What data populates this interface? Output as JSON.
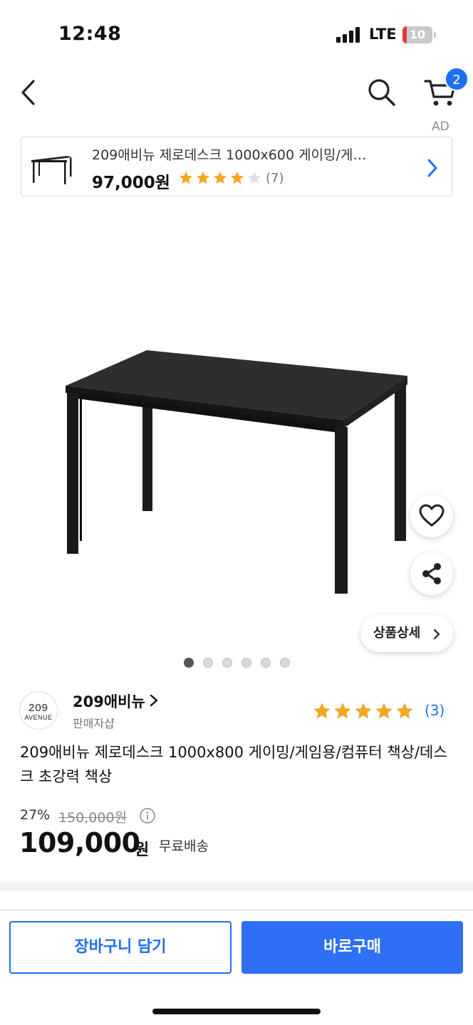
{
  "status_bar": {
    "time": "12:48",
    "network": "LTE",
    "battery_level": "10",
    "battery_color": "#e53935"
  },
  "nav": {
    "back_icon": "chevron-left-icon",
    "search_icon": "search-icon",
    "cart_icon": "cart-icon",
    "cart_count": "2"
  },
  "ad": {
    "label": "AD",
    "title": "209애비뉴 제로데스크 1000x600 게이밍/게…",
    "price": "97,000원",
    "rating_stars": 4,
    "review_count": "(7)"
  },
  "product_image": {
    "alt_icon": "desk-image",
    "wishlist_icon": "heart-icon",
    "share_icon": "share-icon",
    "detail_button": "상품상세",
    "slide_count": 6,
    "active_slide": 1
  },
  "seller": {
    "logo_line1": "209",
    "logo_line2": "AVENUE",
    "name": "209애비뉴",
    "subtitle": "판매자샵",
    "rating_stars": 5,
    "review_count": "(3)"
  },
  "product": {
    "title": "209애비뉴 제로데스크 1000x800 게이밍/게임용/컴퓨터 책상/데스크 초강력 책상",
    "discount": "27%",
    "original_price": "150,000원",
    "price": "109,000",
    "price_unit": "원",
    "shipping": "무료배송"
  },
  "actions": {
    "add_to_cart": "장바구니 담기",
    "buy_now": "바로구매"
  },
  "colors": {
    "accent": "#1e6ff1",
    "buy_button": "#2f6ff5",
    "star": "#f5a623"
  }
}
